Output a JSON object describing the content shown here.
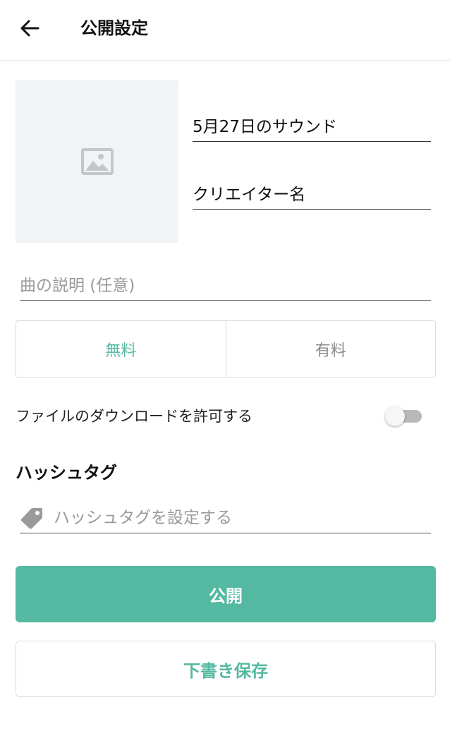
{
  "header": {
    "title": "公開設定",
    "back_icon": "arrow-left-icon"
  },
  "cover": {
    "icon": "image-placeholder-icon"
  },
  "form": {
    "title_value": "5月27日のサウンド",
    "creator_value": "クリエイター名",
    "description_placeholder": "曲の説明 (任意)"
  },
  "pricing": {
    "free_label": "無料",
    "paid_label": "有料",
    "selected": "無料"
  },
  "download": {
    "label": "ファイルのダウンロードを許可する",
    "enabled": false
  },
  "hashtag": {
    "heading": "ハッシュタグ",
    "placeholder": "ハッシュタグを設定する",
    "icon": "tag-icon"
  },
  "actions": {
    "publish_label": "公開",
    "draft_label": "下書き保存"
  },
  "colors": {
    "accent": "#55b9a2",
    "toggle_off": "#b9b9b9"
  }
}
